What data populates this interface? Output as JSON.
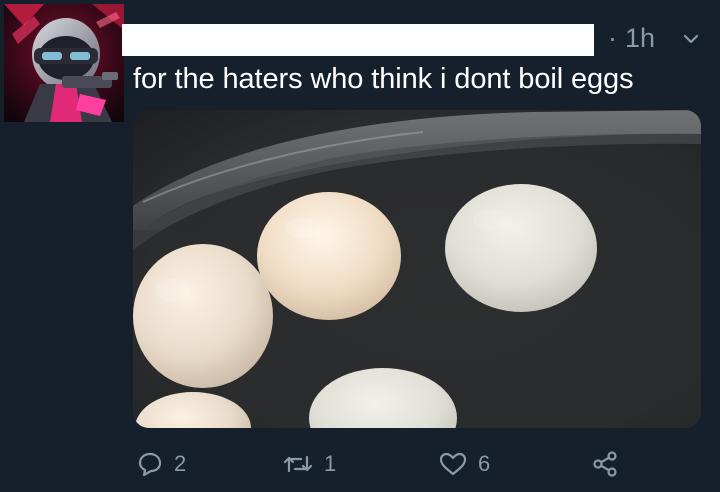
{
  "tweet": {
    "time": "1h",
    "text": "for the haters who think i dont boil eggs",
    "actions": {
      "reply_count": "2",
      "retweet_count": "1",
      "like_count": "6"
    }
  },
  "icons": {
    "caret": "chevron-down-icon",
    "reply": "reply-icon",
    "retweet": "retweet-icon",
    "like": "heart-icon",
    "share": "share-icon"
  },
  "colors": {
    "background": "#16202c",
    "secondary_text": "#8c99a6",
    "primary_text": "#ffffff"
  }
}
